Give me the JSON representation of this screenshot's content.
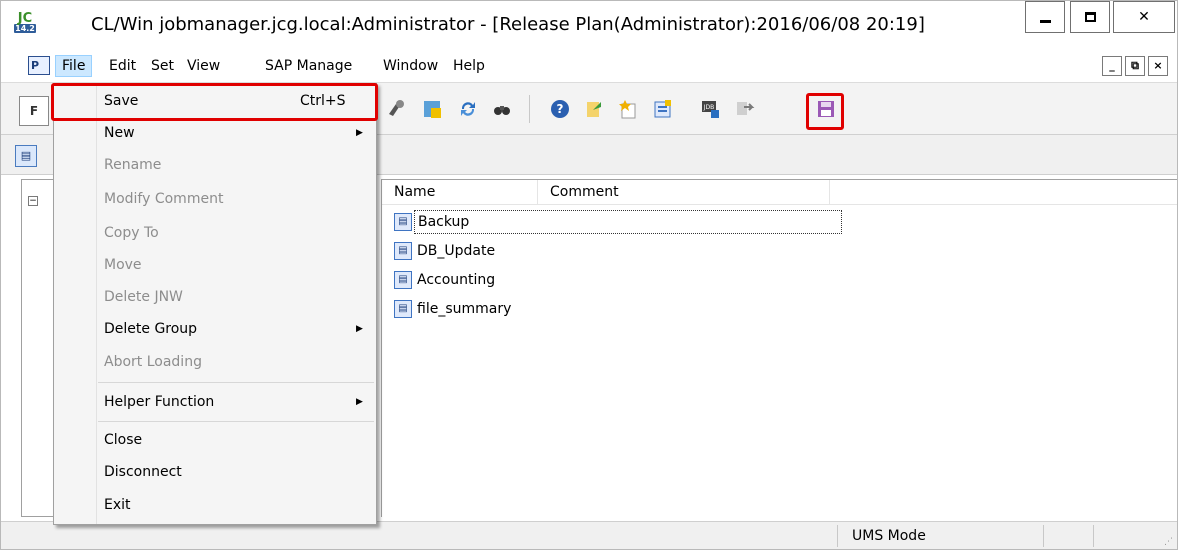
{
  "window": {
    "title": "CL/Win jobmanager.jcg.local:Administrator - [Release Plan(Administrator):2016/06/08 20:19]",
    "app_icon_top": "JC",
    "app_icon_bottom": "14.2"
  },
  "menubar": {
    "doc_icon": "P",
    "items": [
      "File",
      "Edit",
      "Set",
      "View",
      "SAP Manage",
      "Window",
      "Help"
    ],
    "mdi_buttons": [
      "_",
      "⧉",
      "×"
    ]
  },
  "toolbar": {
    "left_button": "F",
    "icons": [
      "search-binoculars-icon",
      "new-plan-icon",
      "refresh-icon",
      "find-icon",
      "help-icon",
      "export-icon",
      "new-star-icon",
      "properties-icon",
      "jdb-icon",
      "transfer-icon",
      "save-disk-icon"
    ]
  },
  "file_menu": {
    "items": [
      {
        "label": "Save",
        "shortcut": "Ctrl+S",
        "enabled": true,
        "submenu": false
      },
      {
        "label": "New",
        "shortcut": "",
        "enabled": true,
        "submenu": true
      },
      {
        "label": "Rename",
        "shortcut": "",
        "enabled": false,
        "submenu": false
      },
      {
        "label": "Modify Comment",
        "shortcut": "",
        "enabled": false,
        "submenu": false
      },
      {
        "label": "Copy To",
        "shortcut": "",
        "enabled": false,
        "submenu": false
      },
      {
        "label": "Move",
        "shortcut": "",
        "enabled": false,
        "submenu": false
      },
      {
        "label": "Delete JNW",
        "shortcut": "",
        "enabled": false,
        "submenu": false
      },
      {
        "label": "Delete Group",
        "shortcut": "",
        "enabled": true,
        "submenu": true
      },
      {
        "label": "Abort Loading",
        "shortcut": "",
        "enabled": false,
        "submenu": false
      },
      {
        "label": "Helper Function",
        "shortcut": "",
        "enabled": true,
        "submenu": true
      },
      {
        "label": "Close",
        "shortcut": "",
        "enabled": true,
        "submenu": false
      },
      {
        "label": "Disconnect",
        "shortcut": "",
        "enabled": true,
        "submenu": false
      },
      {
        "label": "Exit",
        "shortcut": "",
        "enabled": true,
        "submenu": false
      }
    ]
  },
  "list": {
    "columns": [
      "Name",
      "Comment"
    ],
    "rows": [
      {
        "name": "Backup",
        "comment": ""
      },
      {
        "name": "DB_Update",
        "comment": ""
      },
      {
        "name": "Accounting",
        "comment": ""
      },
      {
        "name": "file_summary",
        "comment": ""
      }
    ]
  },
  "statusbar": {
    "mode": "UMS Mode"
  },
  "colors": {
    "highlight": "#e00000",
    "menu_active": "#cce8ff"
  }
}
